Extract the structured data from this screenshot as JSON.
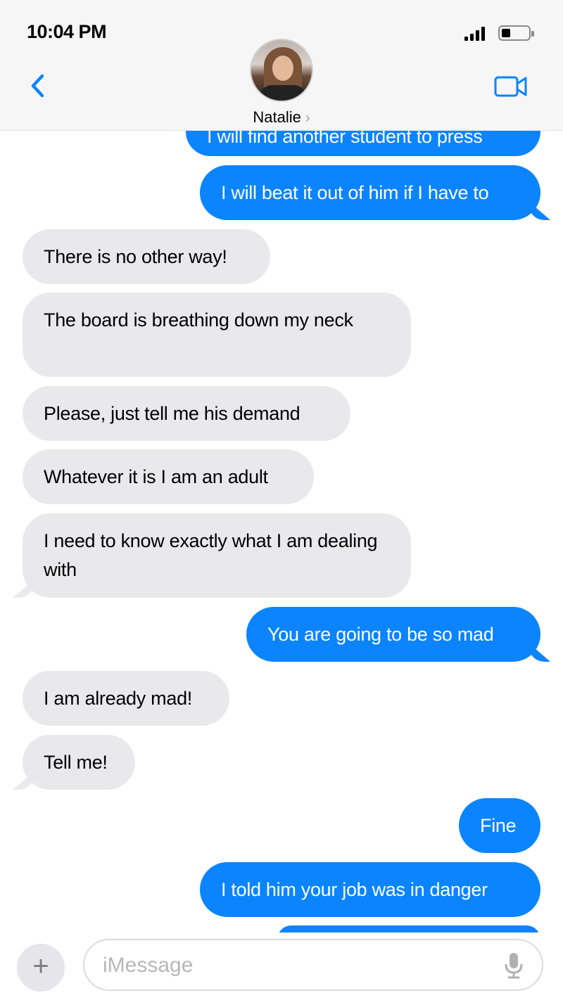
{
  "status_bar": {
    "time": "10:04 PM"
  },
  "header": {
    "contact_name": "Natalie",
    "chevron": "›",
    "back_icon": "chevron-left-icon",
    "video_icon": "video-camera-icon"
  },
  "colors": {
    "outgoing": "#0b84fe",
    "incoming": "#e9e9eb",
    "accent": "#0b84fe"
  },
  "messages": [
    {
      "dir": "out",
      "text": "I will find another student to press"
    },
    {
      "dir": "out",
      "text": "I will beat it out of him if I have to"
    },
    {
      "dir": "in",
      "text": "There is no other way!"
    },
    {
      "dir": "in",
      "text": "The board is breathing down my neck"
    },
    {
      "dir": "in",
      "text": "Please, just tell me his demand"
    },
    {
      "dir": "in",
      "text": "Whatever it is I am an adult"
    },
    {
      "dir": "in",
      "text": "I need to know exactly what I am dealing with"
    },
    {
      "dir": "out",
      "text": "You are going to be so mad"
    },
    {
      "dir": "in",
      "text": "I am already mad!"
    },
    {
      "dir": "in",
      "text": "Tell me!"
    },
    {
      "dir": "out",
      "text": "Fine"
    },
    {
      "dir": "out",
      "text": "I told him your job was in danger"
    }
  ],
  "input": {
    "placeholder": "iMessage",
    "value": "",
    "add_label": "+",
    "mic_icon": "microphone-icon"
  }
}
